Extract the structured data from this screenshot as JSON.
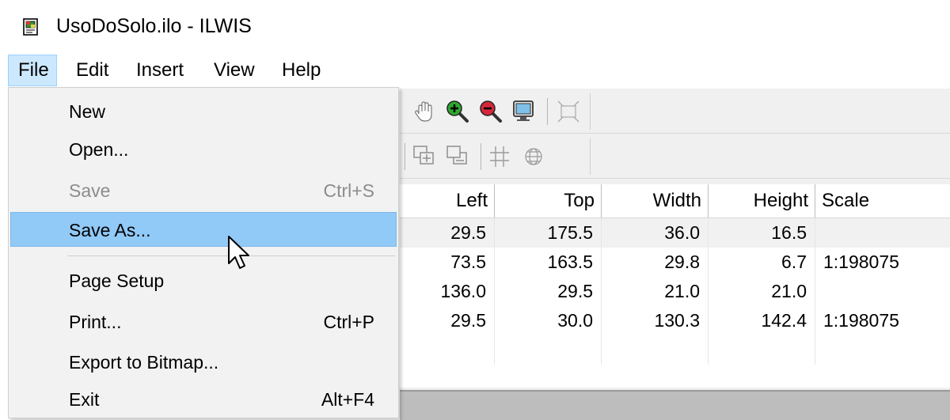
{
  "window": {
    "title": "UsoDoSolo.ilo - ILWIS",
    "icon": "map-document-icon"
  },
  "menubar": {
    "items": [
      "File",
      "Edit",
      "Insert",
      "View",
      "Help"
    ],
    "active": "File"
  },
  "file_menu": {
    "items": [
      {
        "label": "New",
        "shortcut": ""
      },
      {
        "label": "Open...",
        "shortcut": ""
      },
      {
        "label": "Save",
        "shortcut": "Ctrl+S",
        "disabled": true
      },
      {
        "label": "Save As...",
        "shortcut": "",
        "hovered": true
      },
      {
        "label": "Page Setup",
        "shortcut": ""
      },
      {
        "label": "Print...",
        "shortcut": "Ctrl+P"
      },
      {
        "label": "Export to Bitmap...",
        "shortcut": ""
      },
      {
        "label": "Exit",
        "shortcut": "Alt+F4"
      }
    ]
  },
  "toolbar1": {
    "icons": [
      "hand-pan-icon",
      "zoom-in-icon",
      "zoom-out-icon",
      "entire-map-icon",
      "fit-page-icon"
    ]
  },
  "toolbar2": {
    "icons": [
      "bring-to-front-icon",
      "send-to-back-icon",
      "grid-icon",
      "graticule-icon"
    ]
  },
  "table": {
    "columns": [
      "Left",
      "Top",
      "Width",
      "Height",
      "Scale"
    ],
    "rows": [
      [
        "29.5",
        "175.5",
        "36.0",
        "16.5",
        ""
      ],
      [
        "73.5",
        "163.5",
        "29.8",
        "6.7",
        "1:198075"
      ],
      [
        "136.0",
        "29.5",
        "21.0",
        "21.0",
        ""
      ],
      [
        "29.5",
        "30.0",
        "130.3",
        "142.4",
        "1:198075"
      ],
      [
        "",
        "",
        "",
        "",
        ""
      ]
    ]
  },
  "colors": {
    "menu_hover": "#91c9f7",
    "menubar_active": "#cce8ff",
    "disabled_text": "#8c8c8c"
  }
}
